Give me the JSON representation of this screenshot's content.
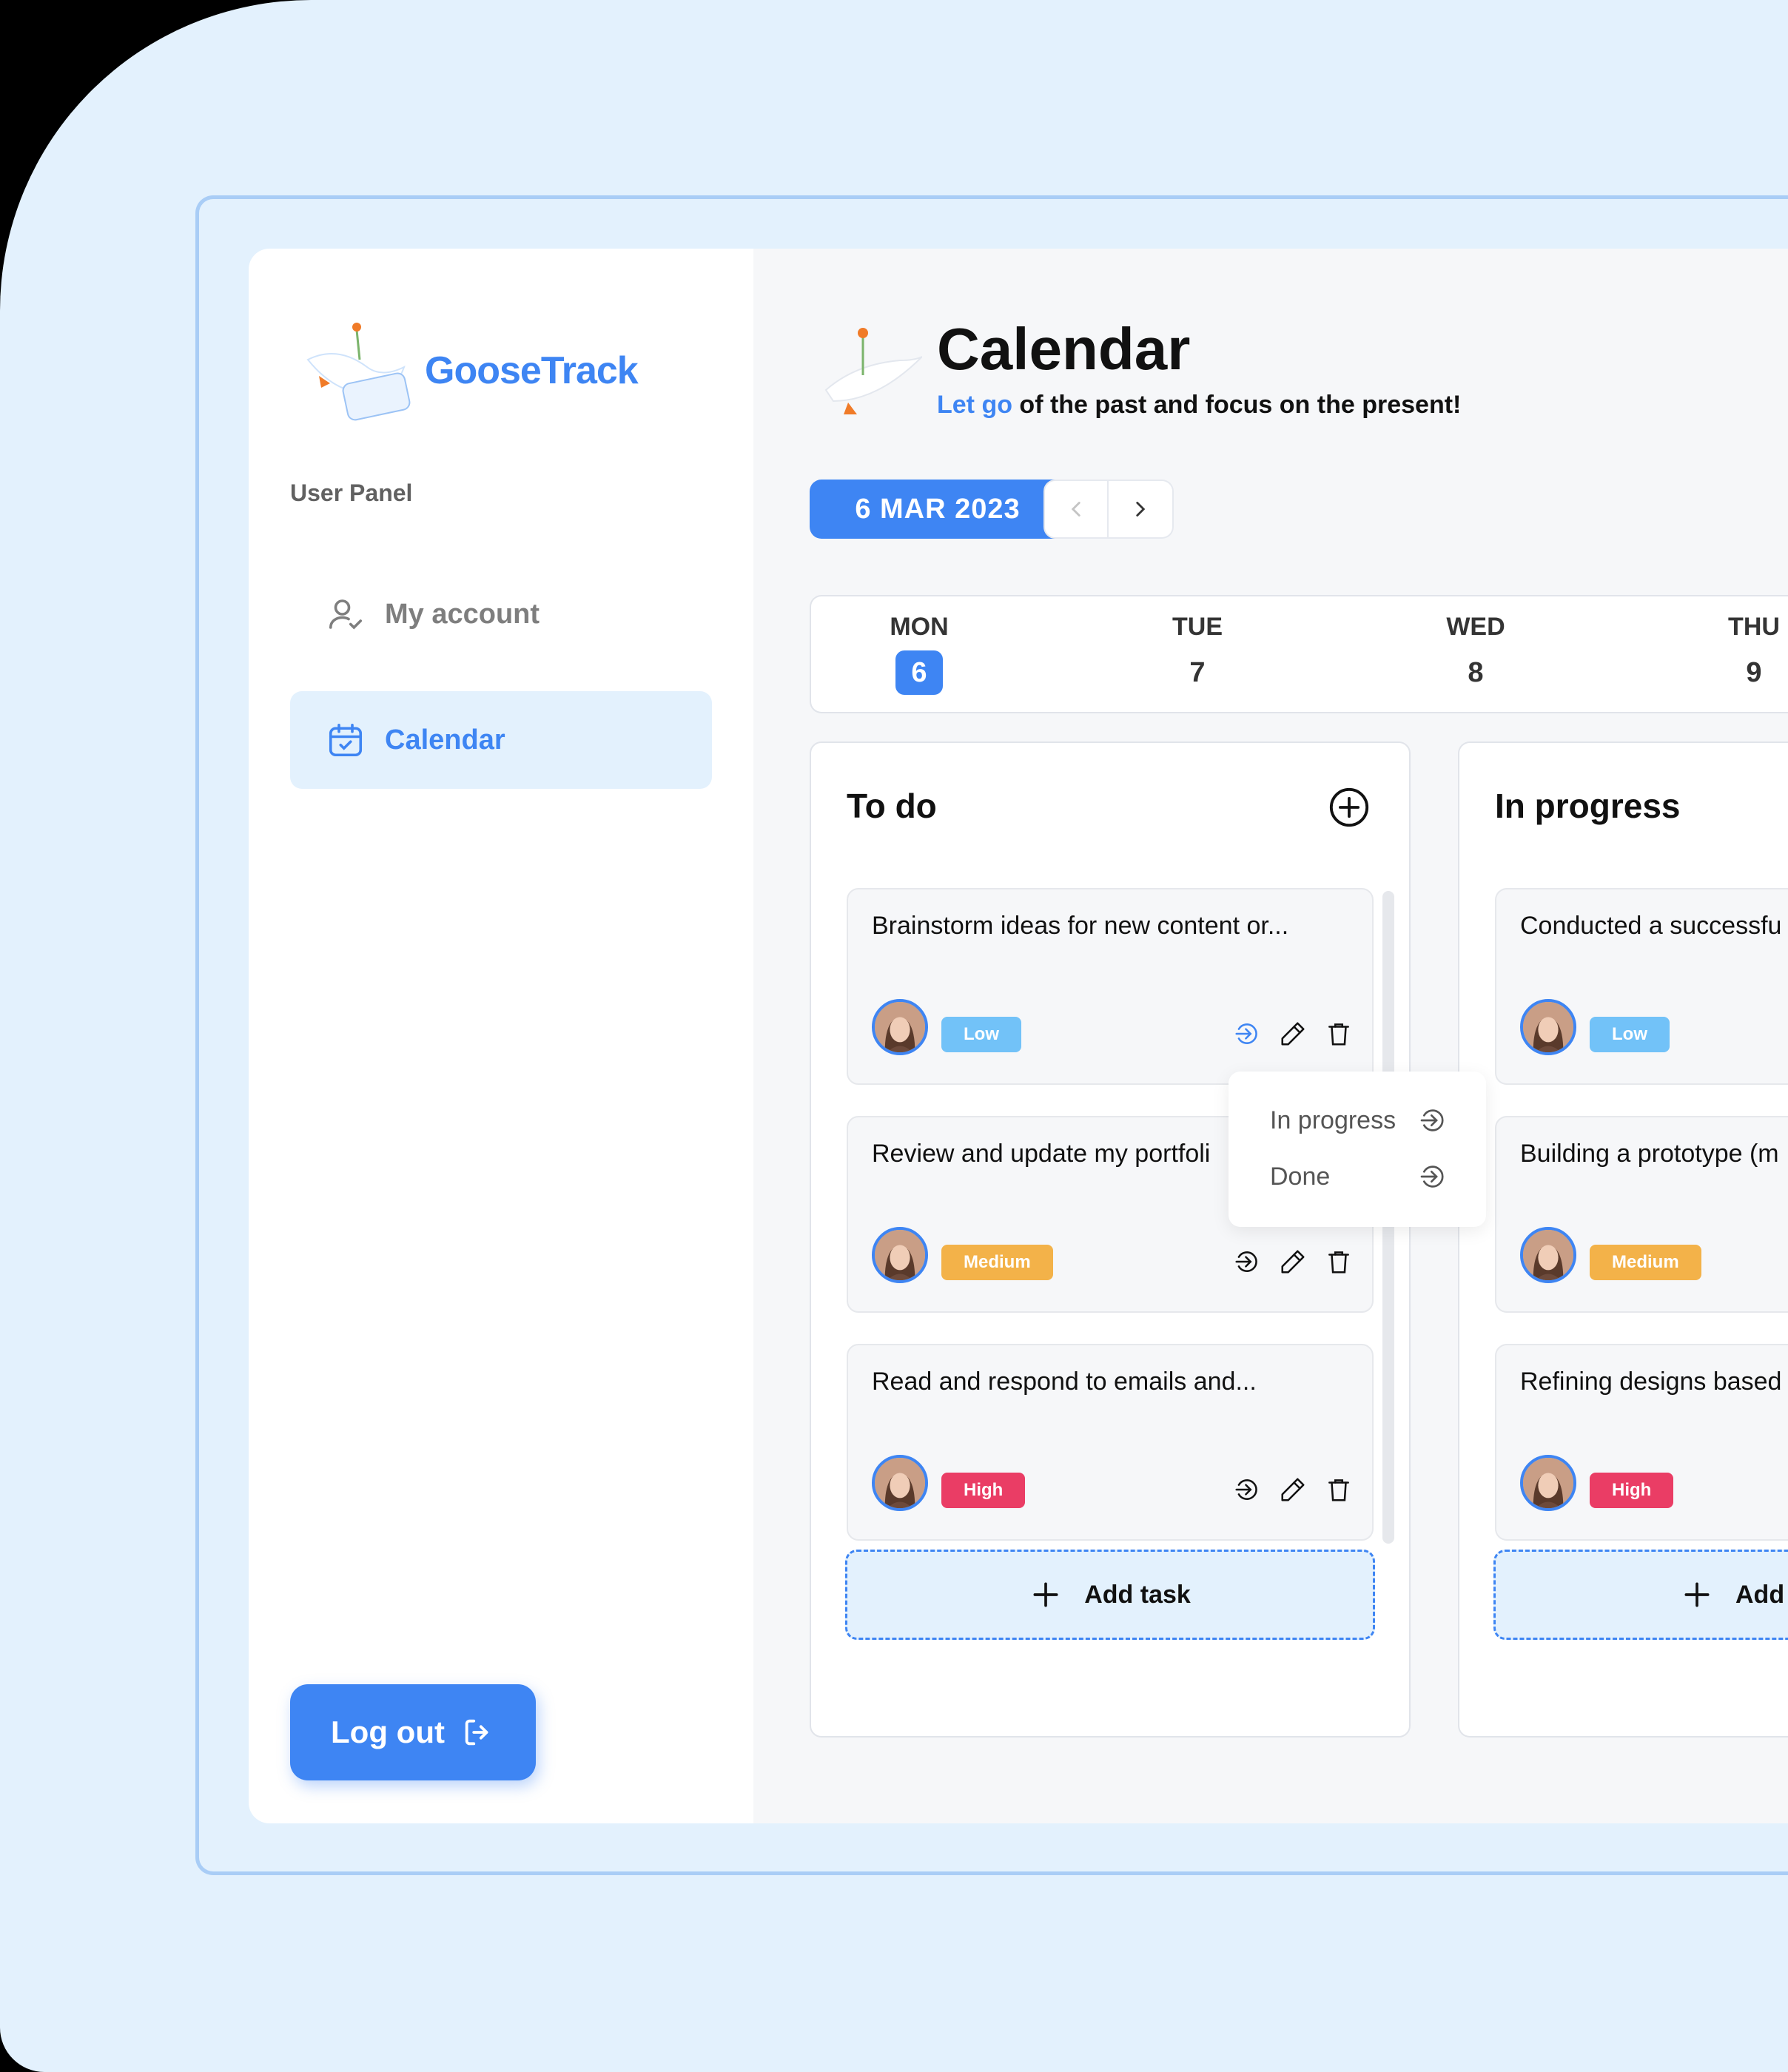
{
  "app": {
    "logo_text": "GooseTrack"
  },
  "sidebar": {
    "panel_label": "User Panel",
    "items": [
      {
        "label": "My account",
        "icon": "user-check-icon"
      },
      {
        "label": "Calendar",
        "icon": "calendar-check-icon",
        "active": true
      }
    ],
    "logout_label": "Log out"
  },
  "header": {
    "title": "Calendar",
    "subtitle_accent": "Let go",
    "subtitle_rest": " of the past and focus on the present!"
  },
  "date_picker": {
    "current": "6 MAR 2023"
  },
  "week": [
    {
      "name": "MON",
      "date": "6",
      "active": true
    },
    {
      "name": "TUE",
      "date": "7"
    },
    {
      "name": "WED",
      "date": "8"
    },
    {
      "name": "THU",
      "date": "9"
    }
  ],
  "columns": [
    {
      "title": "To do",
      "add_task_label": "Add task",
      "tasks": [
        {
          "title": "Brainstorm ideas for new content or...",
          "priority": "Low"
        },
        {
          "title": "Review and update my portfoli",
          "priority": "Medium"
        },
        {
          "title": "Read and respond to emails and...",
          "priority": "High"
        }
      ]
    },
    {
      "title": "In progress",
      "add_task_label": "Add",
      "tasks": [
        {
          "title": "Conducted a successfu",
          "priority": "Low"
        },
        {
          "title": "Building a prototype (m",
          "priority": "Medium"
        },
        {
          "title": "Refining designs based",
          "priority": "High"
        }
      ]
    }
  ],
  "move_menu": {
    "items": [
      "In progress",
      "Done"
    ]
  },
  "colors": {
    "accent": "#3e85f3",
    "low": "#72c2f8",
    "medium": "#f3b249",
    "high": "#ea3d65"
  }
}
